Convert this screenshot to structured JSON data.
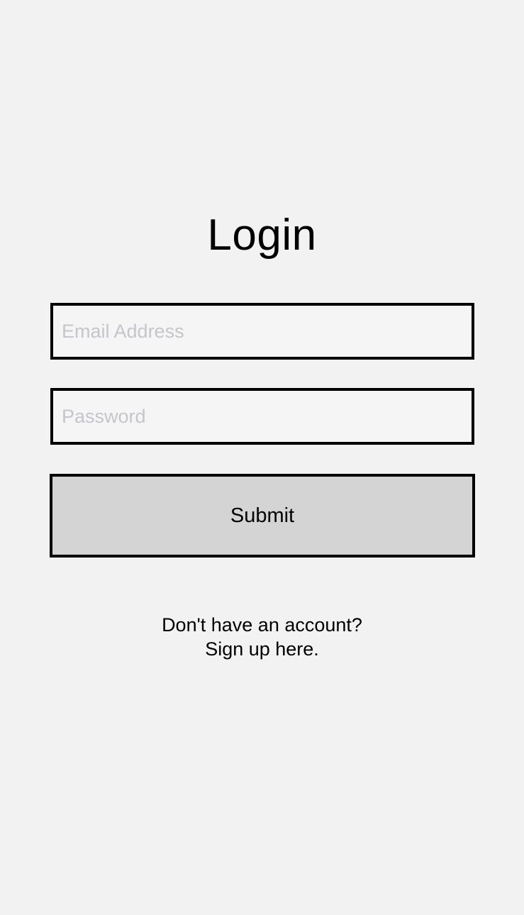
{
  "login": {
    "title": "Login",
    "email_placeholder": "Email Address",
    "password_placeholder": "Password",
    "submit_label": "Submit",
    "signup_prompt": "Don't have an account?",
    "signup_link": "Sign up here."
  }
}
